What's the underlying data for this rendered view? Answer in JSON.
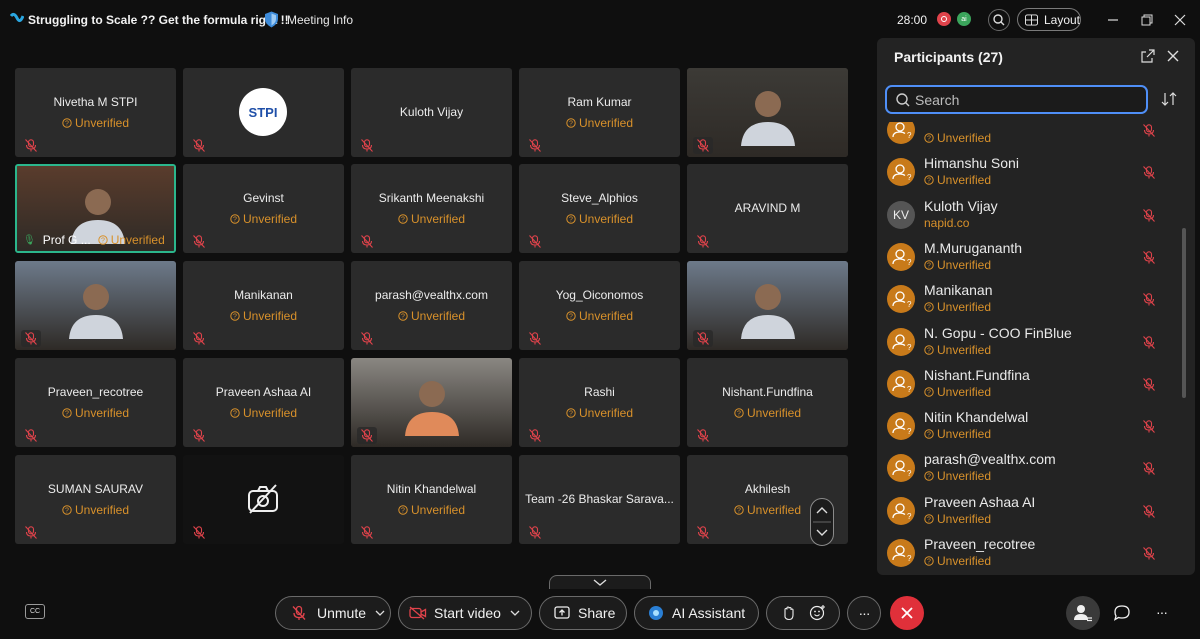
{
  "topbar": {
    "meeting_title": "Struggling to Scale ?? Get the formula right !!",
    "meeting_info_label": "Meeting Info",
    "timer": "28:00",
    "ai_badge": "ai",
    "layout_label": "Layout"
  },
  "grid": {
    "tiles": [
      {
        "name": "Nivetha M STPI",
        "status": "Unverified"
      },
      {
        "name": "STPI",
        "logo": true
      },
      {
        "name": "Kuloth Vijay",
        "status": ""
      },
      {
        "name": "Ram Kumar",
        "status": "Unverified"
      },
      {
        "name": "",
        "video": true
      },
      {
        "name": "Prof G ...",
        "status": "Unverified",
        "video": true
      },
      {
        "name": "Gevinst",
        "status": "Unverified"
      },
      {
        "name": "Srikanth Meenakshi",
        "status": "Unverified"
      },
      {
        "name": "Steve_Alphios",
        "status": "Unverified"
      },
      {
        "name": "ARAVIND M",
        "status": ""
      },
      {
        "name": "",
        "video": true
      },
      {
        "name": "Manikanan",
        "status": "Unverified"
      },
      {
        "name": "parash@vealthx.com",
        "status": "Unverified"
      },
      {
        "name": "Yog_Oiconomos",
        "status": "Unverified"
      },
      {
        "name": "",
        "video": true
      },
      {
        "name": "Praveen_recotree",
        "status": "Unverified"
      },
      {
        "name": "Praveen Ashaa AI",
        "status": "Unverified"
      },
      {
        "name": "",
        "video": true
      },
      {
        "name": "Rashi",
        "status": "Unverified"
      },
      {
        "name": "Nishant.Fundfina",
        "status": "Unverified"
      },
      {
        "name": "SUMAN SAURAV",
        "status": "Unverified"
      },
      {
        "name": "",
        "camera_off": true
      },
      {
        "name": "Nitin Khandelwal",
        "status": "Unverified"
      },
      {
        "name": "Team -26 Bhaskar Sarava...",
        "status": ""
      },
      {
        "name": "Akhilesh",
        "status": "Unverified"
      }
    ]
  },
  "participants": {
    "title": "Participants (27)",
    "search_placeholder": "Search",
    "list": [
      {
        "name": "",
        "sub": "Unverified"
      },
      {
        "name": "Himanshu Soni",
        "sub": "Unverified"
      },
      {
        "name": "Kuloth Vijay",
        "sub": "napid.co",
        "initials": "KV"
      },
      {
        "name": "M.Murugananth",
        "sub": "Unverified"
      },
      {
        "name": "Manikanan",
        "sub": "Unverified"
      },
      {
        "name": "N. Gopu - COO FinBlue",
        "sub": "Unverified"
      },
      {
        "name": "Nishant.Fundfina",
        "sub": "Unverified"
      },
      {
        "name": "Nitin Khandelwal",
        "sub": "Unverified"
      },
      {
        "name": "parash@vealthx.com",
        "sub": "Unverified"
      },
      {
        "name": "Praveen Ashaa AI",
        "sub": "Unverified"
      },
      {
        "name": "Praveen_recotree",
        "sub": "Unverified"
      }
    ]
  },
  "toolbar": {
    "cc_label": "CC",
    "unmute_label": "Unmute",
    "start_video_label": "Start video",
    "share_label": "Share",
    "ai_assistant_label": "AI Assistant",
    "more_label": "···"
  },
  "colors": {
    "unverified": "#d8912b",
    "accent_blue": "#4f8ff7",
    "end_red": "#e0303a",
    "selected_tile": "#2bb68c"
  }
}
